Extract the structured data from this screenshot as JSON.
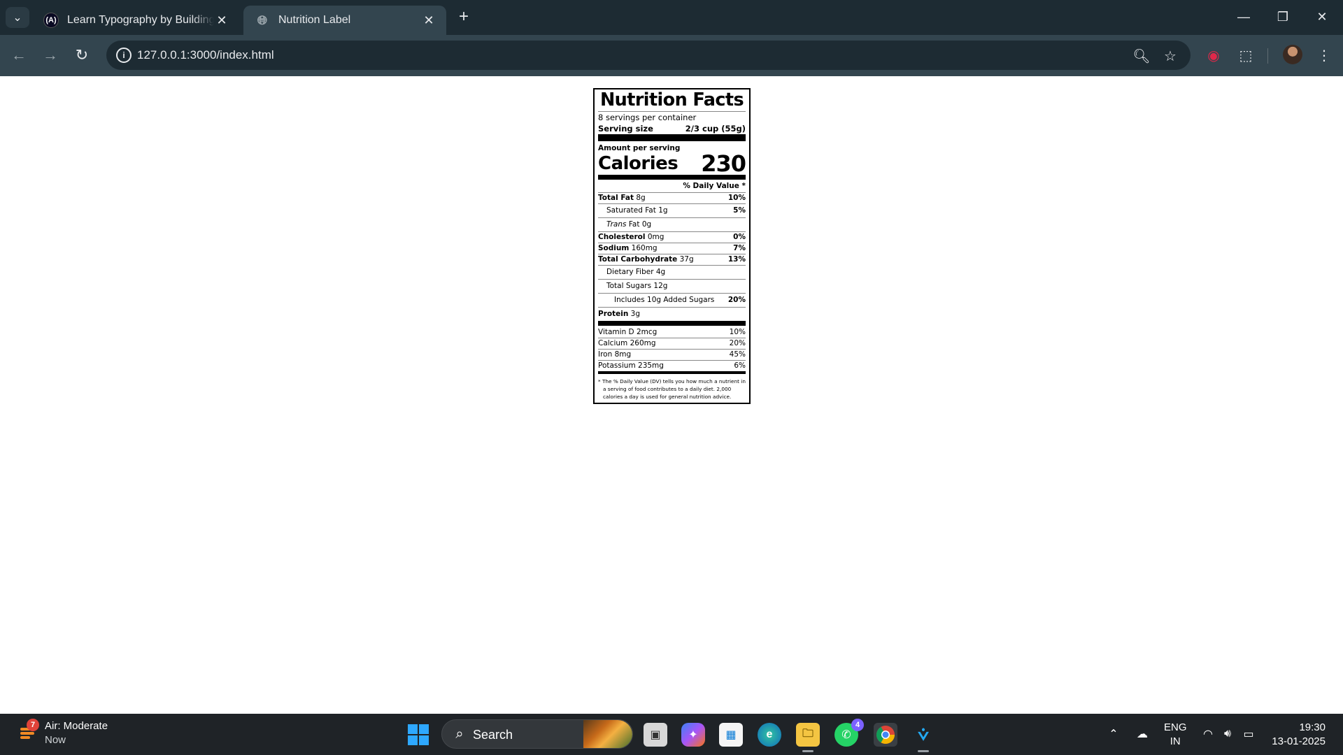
{
  "browser": {
    "tabs": [
      {
        "favicon": "(A)",
        "title": "Learn Typography by Building a Nutrition Label",
        "active": false
      },
      {
        "favicon": "globe-icon",
        "title": "Nutrition Label",
        "active": true
      }
    ],
    "new_tab_glyph": "+",
    "url": "127.0.0.1:3000/index.html"
  },
  "label": {
    "heading": "Nutrition Facts",
    "servings": "8 servings per container",
    "serving_size_label": "Serving size",
    "serving_size_value": "2/3 cup (55g)",
    "amount_per_serving": "Amount per serving",
    "calories_label": "Calories",
    "calories_value": "230",
    "dv_heading": "% Daily Value *",
    "nutrients": [
      {
        "name": "Total Fat",
        "amount": "8g",
        "dv": "10%"
      },
      {
        "name": "Saturated Fat",
        "amount": "1g",
        "dv": "5%"
      },
      {
        "name": "Trans",
        "name_rest": "Fat",
        "amount": "0g",
        "dv": ""
      },
      {
        "name": "Cholesterol",
        "amount": "0mg",
        "dv": "0%"
      },
      {
        "name": "Sodium",
        "amount": "160mg",
        "dv": "7%"
      },
      {
        "name": "Total Carbohydrate",
        "amount": "37g",
        "dv": "13%"
      },
      {
        "name": "Dietary Fiber",
        "amount": "4g",
        "dv": ""
      },
      {
        "name": "Total Sugars",
        "amount": "12g",
        "dv": ""
      },
      {
        "name": "Includes 10g Added Sugars",
        "amount": "",
        "dv": "20%"
      },
      {
        "name": "Protein",
        "amount": "3g",
        "dv": ""
      }
    ],
    "micros": [
      {
        "name": "Vitamin D 2mcg",
        "dv": "10%"
      },
      {
        "name": "Calcium 260mg",
        "dv": "20%"
      },
      {
        "name": "Iron 8mg",
        "dv": "45%"
      },
      {
        "name": "Potassium 235mg",
        "dv": "6%"
      }
    ],
    "footnote": "* The % Daily Value (DV) tells you how much a nutrient in a serving of food contributes to a daily diet. 2,000 calories a day is used for general nutrition advice."
  },
  "taskbar": {
    "weather_title": "Air: Moderate",
    "weather_sub": "Now",
    "weather_badge": "7",
    "search_label": "Search",
    "whatsapp_badge": "4",
    "lang_top": "ENG",
    "lang_bottom": "IN",
    "time": "19:30",
    "date": "13-01-2025"
  },
  "colors": {
    "tabbar_bg": "#1d2b33",
    "toolbar_bg": "#33454f",
    "taskbar_bg": "#1f2327",
    "accent_start": "#2ea8ff"
  }
}
